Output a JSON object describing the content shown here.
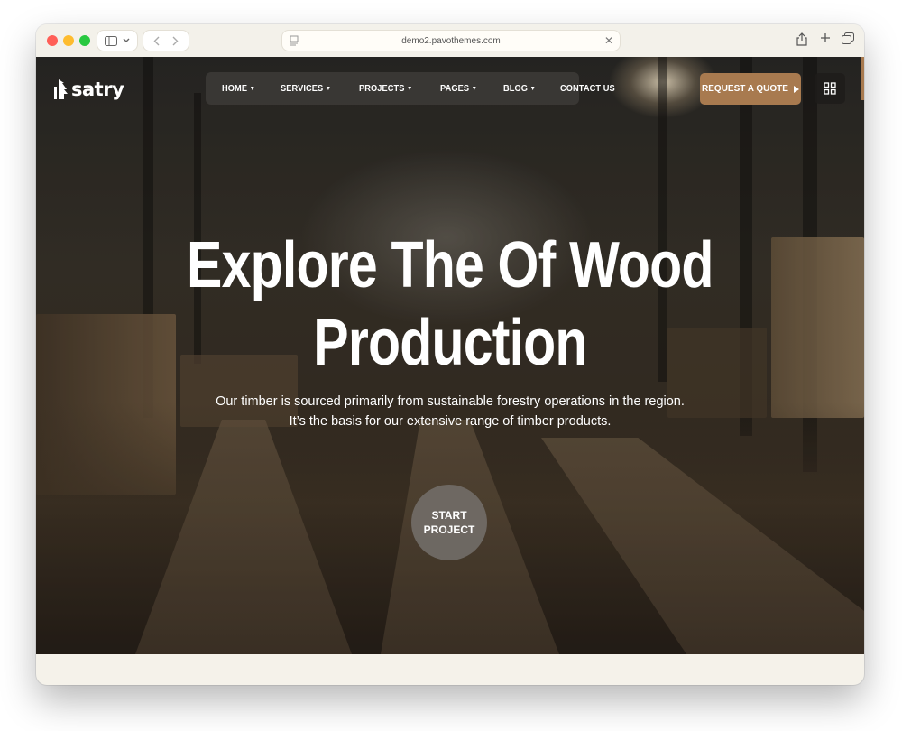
{
  "browser": {
    "url": "demo2.pavothemes.com"
  },
  "site": {
    "logo_text": "satry",
    "menu": [
      {
        "label": "HOME",
        "has_dropdown": true
      },
      {
        "label": "SERVICES",
        "has_dropdown": true
      },
      {
        "label": "PROJECTS",
        "has_dropdown": true
      },
      {
        "label": "PAGES",
        "has_dropdown": true
      },
      {
        "label": "BLOG",
        "has_dropdown": true
      },
      {
        "label": "CONTACT US",
        "has_dropdown": false
      }
    ],
    "quote_button": "REQUEST A QUOTE",
    "hero": {
      "title_line1": "Explore The Of Wood",
      "title_line2": "Production",
      "subtitle_line1": "Our timber is sourced primarily from sustainable forestry operations in the region.",
      "subtitle_line2": "It’s the basis for our extensive range of timber products.",
      "cta_line1": "START",
      "cta_line2": "PROJECT"
    }
  },
  "colors": {
    "accent": "#a87a4f",
    "menu_bg": "#3c3a37",
    "page_bg": "#f5f2ea"
  },
  "icons": [
    "sidebar-icon",
    "chevron-down-icon",
    "back-icon",
    "forward-icon",
    "page-icon",
    "close-icon",
    "share-icon",
    "plus-icon",
    "tabs-icon",
    "tree-logo-icon",
    "arrow-right-icon",
    "grid-icon"
  ]
}
